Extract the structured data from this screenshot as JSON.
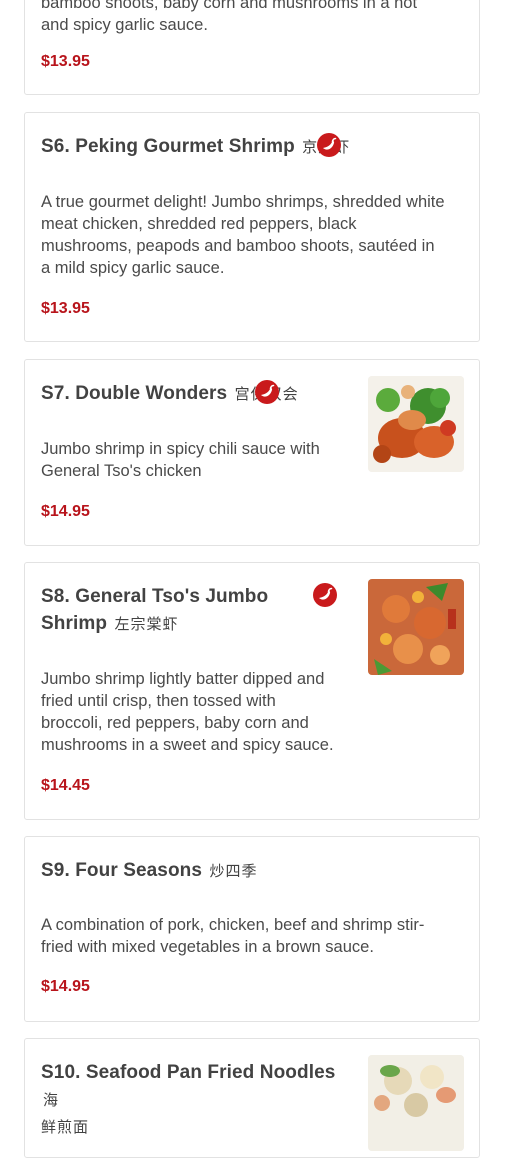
{
  "items": [
    {
      "id": "s5",
      "desc_line1": "bamboo shoots, baby corn and mushrooms in a hot",
      "desc_line2": "and spicy garlic sauce.",
      "price": "$13.95"
    },
    {
      "id": "s6",
      "name": "S6. Peking Gourmet Shrimp",
      "cjk": "京炒虾",
      "spicy": true,
      "desc_lines": [
        "A true gourmet delight! Jumbo shrimps, shredded white",
        "meat chicken, shredded red peppers, black",
        "mushrooms, peapods and bamboo shoots, sautéed in",
        "a mild spicy garlic sauce."
      ],
      "price": "$13.95"
    },
    {
      "id": "s7",
      "name": "S7. Double Wonders",
      "cjk": "宫保双会",
      "spicy": true,
      "desc_lines": [
        "Jumbo shrimp in spicy chili sauce with",
        "General Tso's chicken"
      ],
      "price": "$14.95",
      "icon": "food-photo"
    },
    {
      "id": "s8",
      "name_line1": "S8. General Tso's Jumbo",
      "name_line2": "Shrimp",
      "cjk": "左宗棠虾",
      "spicy": true,
      "desc_lines": [
        "Jumbo shrimp lightly batter dipped and",
        "fried until crisp, then tossed with",
        "broccoli, red peppers, baby corn and",
        "mushrooms in a sweet and spicy sauce."
      ],
      "price": "$14.45",
      "icon": "food-photo"
    },
    {
      "id": "s9",
      "name": "S9. Four Seasons",
      "cjk": "炒四季",
      "spicy": false,
      "desc_lines": [
        "A combination of pork, chicken, beef and shrimp stir-",
        "fried with mixed vegetables in a brown sauce."
      ],
      "price": "$14.95"
    },
    {
      "id": "s10",
      "name": "S10. Seafood Pan Fried Noodles",
      "cjk1": "海",
      "cjk2": "鲜煎面",
      "spicy": false,
      "icon": "food-photo"
    }
  ],
  "colors": {
    "price": "#b8141b",
    "spicy_badge": "#c91a1c",
    "card_border": "#e2e2e2"
  },
  "icons": {
    "spicy": "chili-pepper-icon"
  }
}
